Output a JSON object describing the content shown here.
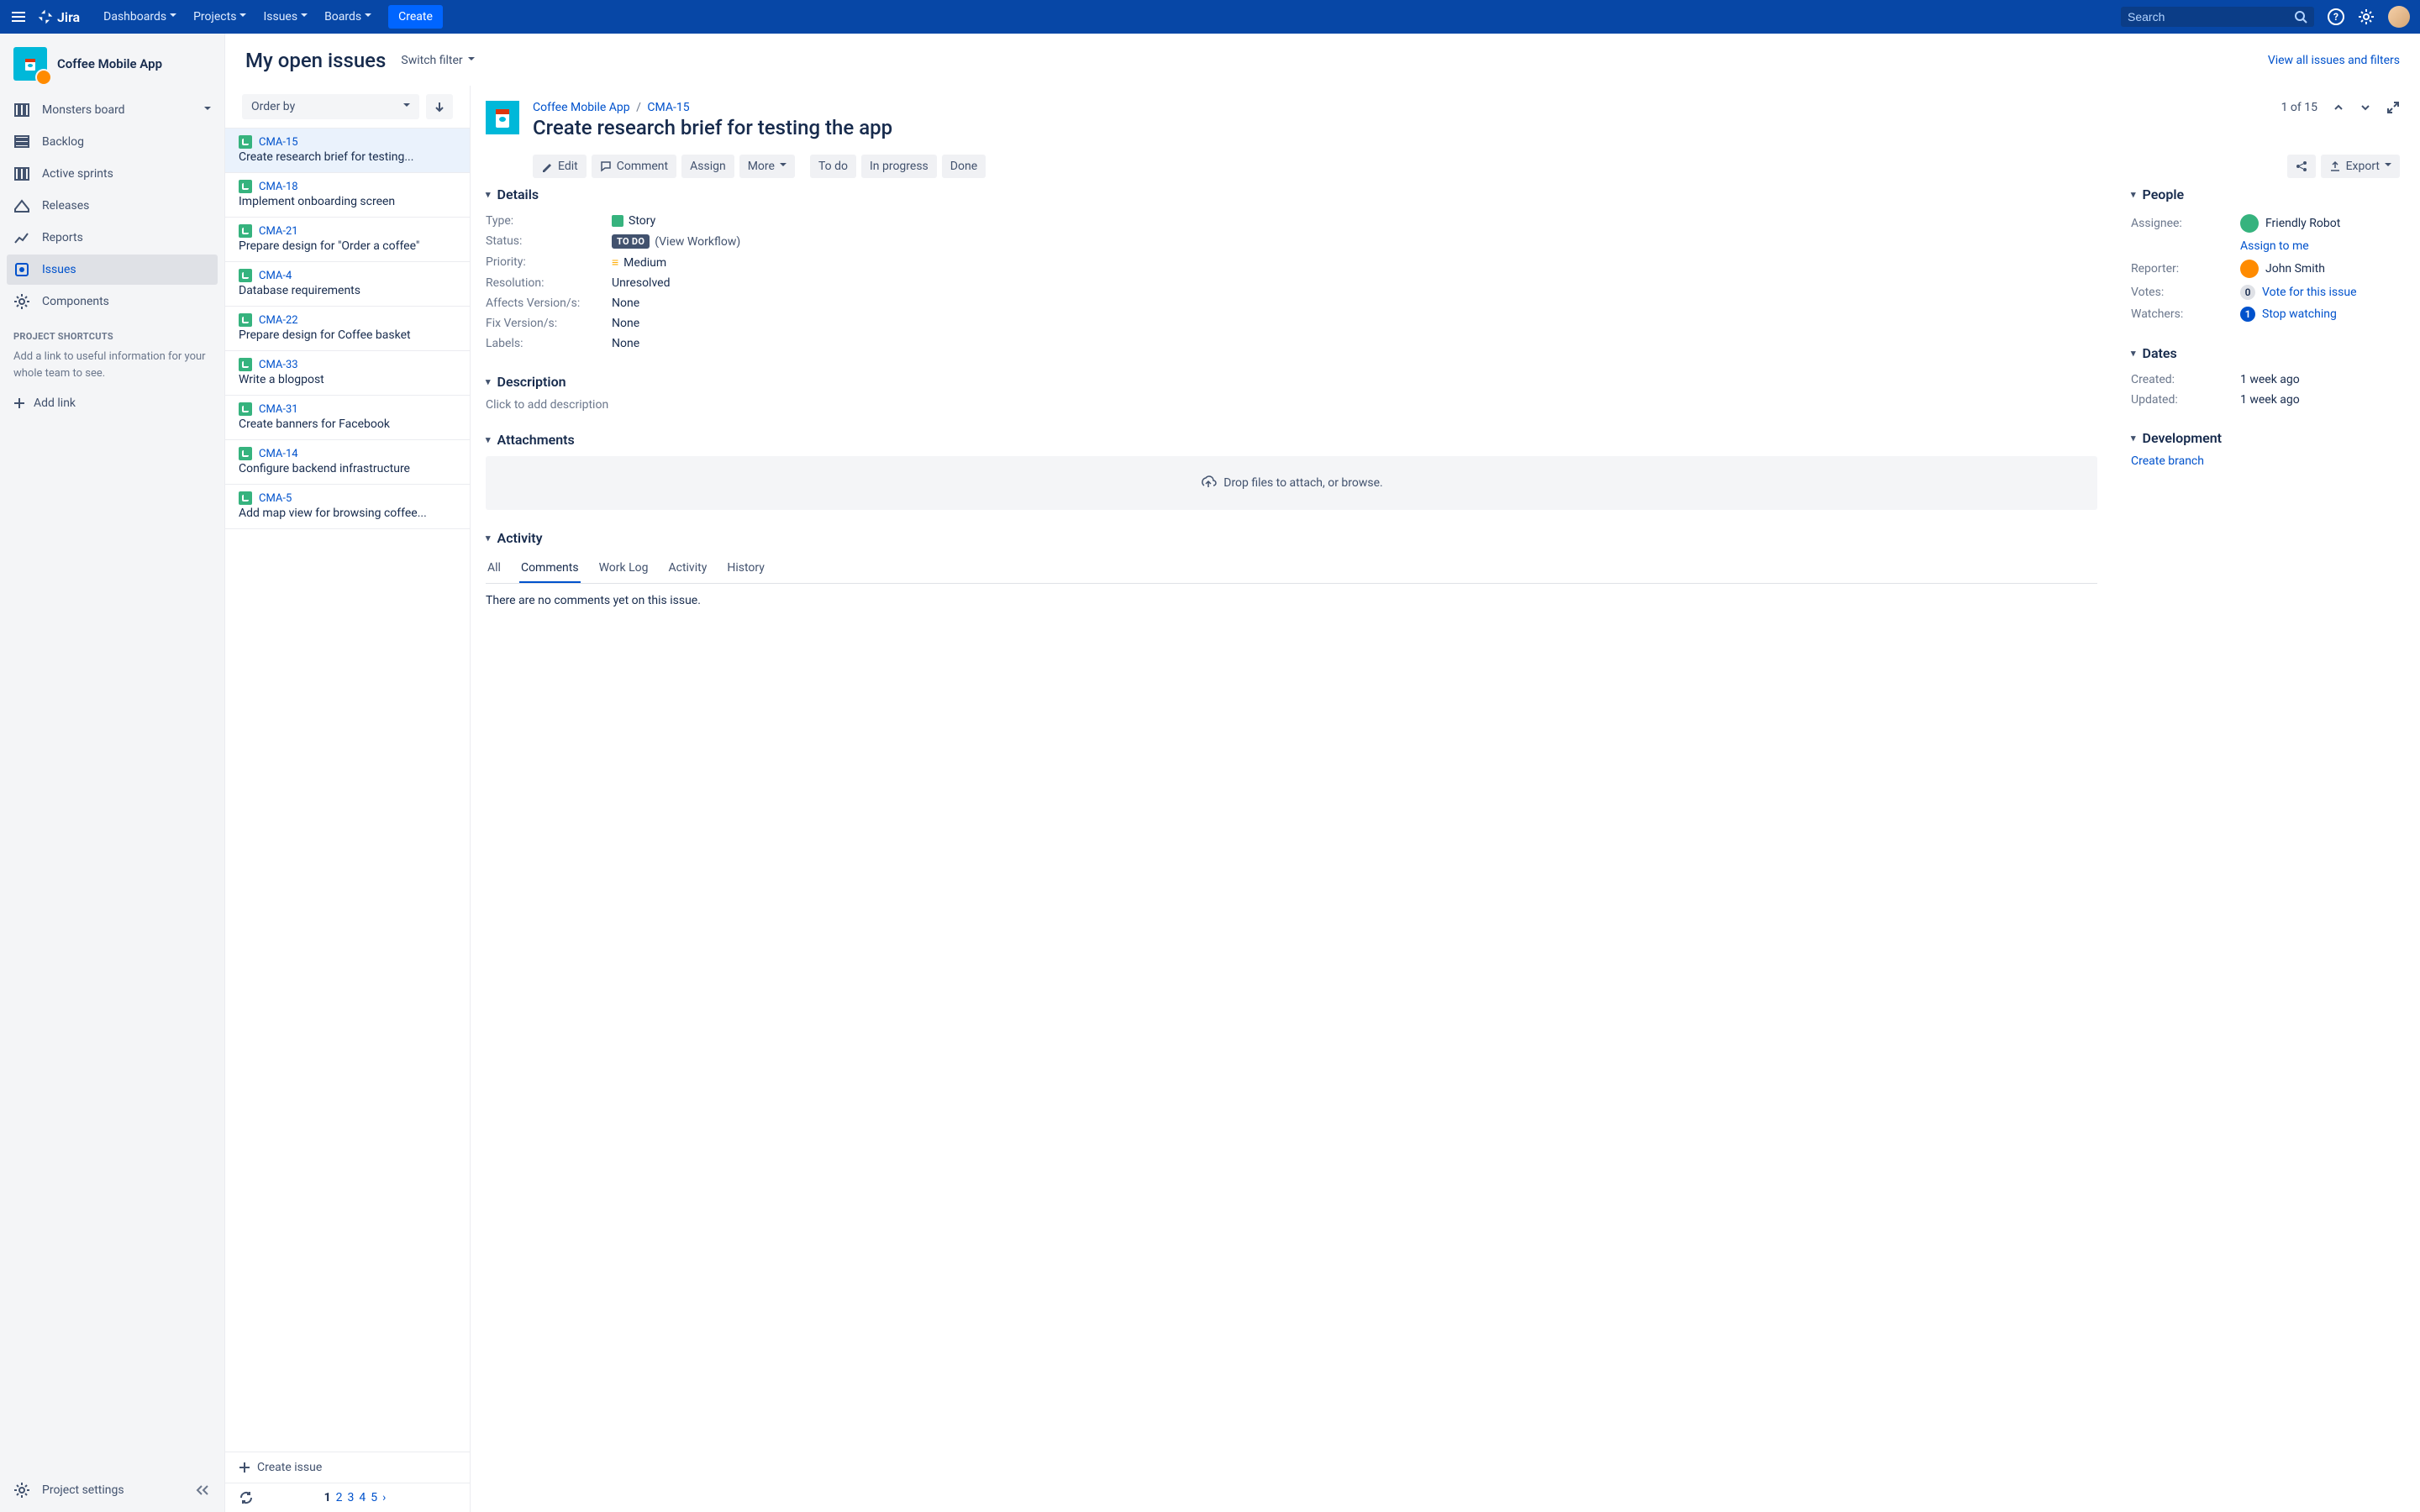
{
  "topnav": {
    "logo": "Jira",
    "menu": [
      "Dashboards",
      "Projects",
      "Issues",
      "Boards"
    ],
    "create": "Create",
    "search_placeholder": "Search"
  },
  "sidebar": {
    "project": "Coffee Mobile App",
    "items": [
      {
        "label": "Monsters board",
        "expandable": true
      },
      {
        "label": "Backlog"
      },
      {
        "label": "Active sprints"
      },
      {
        "label": "Releases"
      },
      {
        "label": "Reports"
      },
      {
        "label": "Issues",
        "active": true
      },
      {
        "label": "Components"
      }
    ],
    "shortcuts_label": "PROJECT SHORTCUTS",
    "shortcuts_text": "Add a link to useful information for your whole team to see.",
    "add_link": "Add link",
    "settings": "Project settings"
  },
  "header": {
    "title": "My open issues",
    "switch_filter": "Switch filter",
    "view_all": "View all issues and filters"
  },
  "list": {
    "order_by": "Order by",
    "issues": [
      {
        "key": "CMA-15",
        "summary": "Create research brief for testing...",
        "active": true
      },
      {
        "key": "CMA-18",
        "summary": "Implement onboarding screen"
      },
      {
        "key": "CMA-21",
        "summary": "Prepare design for \"Order a coffee\""
      },
      {
        "key": "CMA-4",
        "summary": "Database requirements"
      },
      {
        "key": "CMA-22",
        "summary": "Prepare design for Coffee basket"
      },
      {
        "key": "CMA-33",
        "summary": "Write a blogpost"
      },
      {
        "key": "CMA-31",
        "summary": "Create banners for Facebook"
      },
      {
        "key": "CMA-14",
        "summary": "Configure backend infrastructure"
      },
      {
        "key": "CMA-5",
        "summary": "Add map view for browsing coffee..."
      }
    ],
    "create_issue": "Create issue",
    "pages": [
      "1",
      "2",
      "3",
      "4",
      "5"
    ]
  },
  "detail": {
    "breadcrumb_project": "Coffee Mobile App",
    "breadcrumb_key": "CMA-15",
    "title": "Create research brief for testing the app",
    "counter": "1 of 15",
    "actions": {
      "edit": "Edit",
      "comment": "Comment",
      "assign": "Assign",
      "more": "More",
      "status": [
        "To do",
        "In progress",
        "Done"
      ],
      "export": "Export"
    },
    "details_section": "Details",
    "fields": {
      "type_label": "Type:",
      "type_value": "Story",
      "status_label": "Status:",
      "status_badge": "TO DO",
      "status_workflow": "(View Workflow)",
      "priority_label": "Priority:",
      "priority_value": "Medium",
      "resolution_label": "Resolution:",
      "resolution_value": "Unresolved",
      "affects_label": "Affects Version/s:",
      "affects_value": "None",
      "fix_label": "Fix Version/s:",
      "fix_value": "None",
      "labels_label": "Labels:",
      "labels_value": "None"
    },
    "description_section": "Description",
    "description_placeholder": "Click to add description",
    "attachments_section": "Attachments",
    "attachments_drop": "Drop files to attach, or browse.",
    "activity_section": "Activity",
    "tabs": [
      "All",
      "Comments",
      "Work Log",
      "Activity",
      "History"
    ],
    "active_tab": "Comments",
    "no_comments": "There are no comments yet on this issue.",
    "people_section": "People",
    "people": {
      "assignee_label": "Assignee:",
      "assignee_value": "Friendly Robot",
      "assign_to_me": "Assign to me",
      "reporter_label": "Reporter:",
      "reporter_value": "John Smith",
      "votes_label": "Votes:",
      "votes_count": "0",
      "vote_link": "Vote for this issue",
      "watchers_label": "Watchers:",
      "watchers_count": "1",
      "watch_link": "Stop watching"
    },
    "dates_section": "Dates",
    "dates": {
      "created_label": "Created:",
      "created_value": "1 week ago",
      "updated_label": "Updated:",
      "updated_value": "1 week ago"
    },
    "dev_section": "Development",
    "create_branch": "Create branch"
  }
}
